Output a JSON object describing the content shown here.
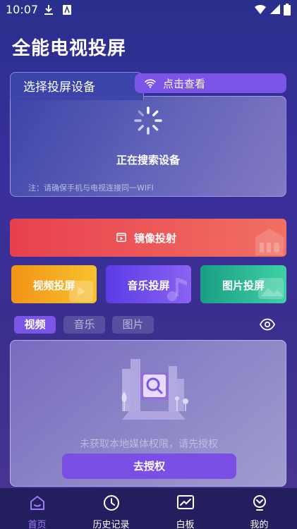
{
  "status_bar": {
    "time": "10:07"
  },
  "app": {
    "title": "全能电视投屏"
  },
  "device_card": {
    "tab_label": "选择投屏设备",
    "pill_label": "点击查看",
    "searching_text": "正在搜索设备",
    "note": "注：请确保手机与电视连接同一WIFI"
  },
  "mirror": {
    "label": "镜像投射",
    "color_start": "#e8404e",
    "color_end": "#f07063"
  },
  "modes": [
    {
      "label": "视频投屏",
      "color_start": "#f29418",
      "color_end": "#f7c12d"
    },
    {
      "label": "音乐投屏",
      "color_start": "#5b3be6",
      "color_end": "#8a63f2"
    },
    {
      "label": "图片投屏",
      "color_start": "#1a9e83",
      "color_end": "#3fd0a4"
    }
  ],
  "media_tabs": [
    {
      "label": "视频",
      "active": true
    },
    {
      "label": "音乐",
      "active": false
    },
    {
      "label": "图片",
      "active": false
    }
  ],
  "media_panel": {
    "permission_text": "未获取本地媒体权限，请先授权",
    "auth_button": "去授权"
  },
  "nav": [
    {
      "label": "首页",
      "icon": "home-icon",
      "active": true
    },
    {
      "label": "历史记录",
      "icon": "clock-icon",
      "active": false
    },
    {
      "label": "白板",
      "icon": "whiteboard-icon",
      "active": false
    },
    {
      "label": "我的",
      "icon": "profile-icon",
      "active": false
    }
  ],
  "colors": {
    "accent": "#7b55e8",
    "nav_active": "#9b7cff"
  }
}
